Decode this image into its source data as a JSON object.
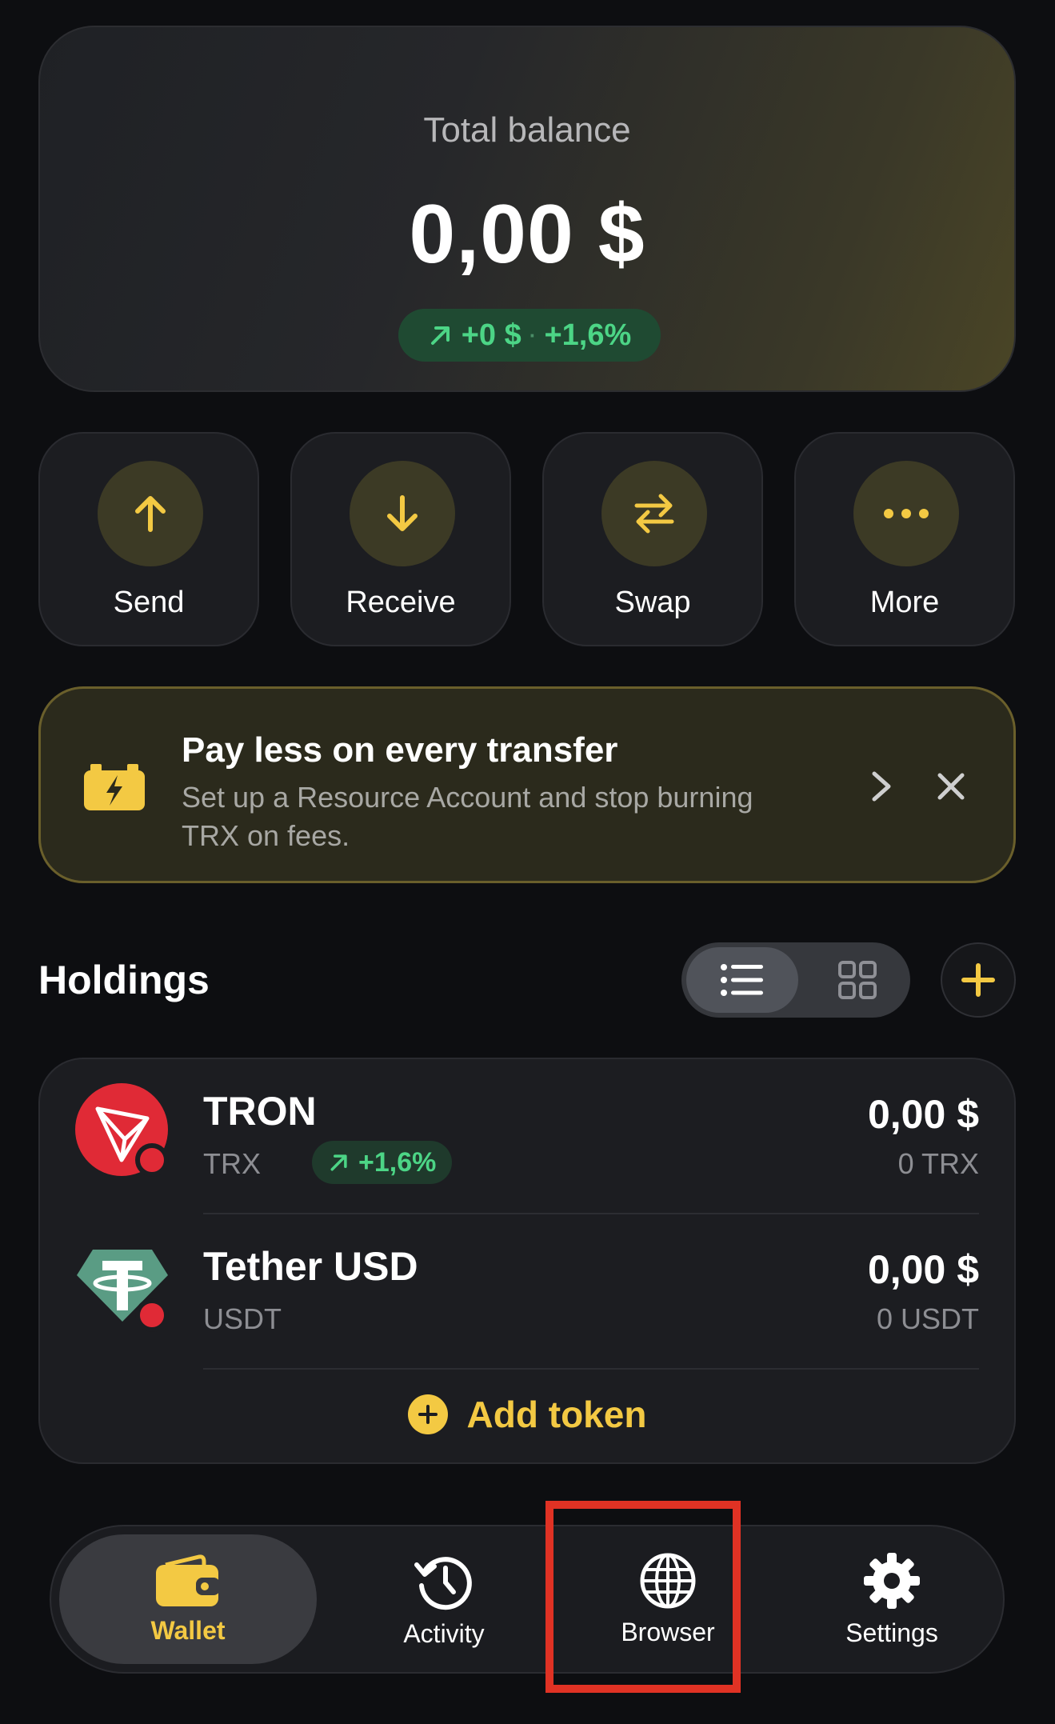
{
  "balance": {
    "title": "Total balance",
    "amount": "0,00 $",
    "change_value": "+0 $",
    "change_separator": "·",
    "change_percent": "+1,6%"
  },
  "actions": [
    {
      "label": "Send",
      "icon": "arrow-up-icon"
    },
    {
      "label": "Receive",
      "icon": "arrow-down-icon"
    },
    {
      "label": "Swap",
      "icon": "swap-icon"
    },
    {
      "label": "More",
      "icon": "more-icon"
    }
  ],
  "promo": {
    "title": "Pay less on every transfer",
    "description": "Set up a Resource Account and stop burning TRX on fees."
  },
  "holdings": {
    "title": "Holdings",
    "tokens": [
      {
        "name": "TRON",
        "symbol": "TRX",
        "change": "+1,6%",
        "fiat": "0,00 $",
        "amount": "0 TRX"
      },
      {
        "name": "Tether USD",
        "symbol": "USDT",
        "fiat": "0,00 $",
        "amount": "0 USDT"
      }
    ],
    "add_token_label": "Add token"
  },
  "nav": [
    {
      "label": "Wallet",
      "icon": "wallet-icon",
      "active": true
    },
    {
      "label": "Activity",
      "icon": "history-icon",
      "active": false
    },
    {
      "label": "Browser",
      "icon": "globe-icon",
      "active": false
    },
    {
      "label": "Settings",
      "icon": "gear-icon",
      "active": false
    }
  ],
  "colors": {
    "accent": "#f3c943",
    "positive": "#4cd586",
    "background": "#0d0e11",
    "highlight": "#e03224"
  }
}
